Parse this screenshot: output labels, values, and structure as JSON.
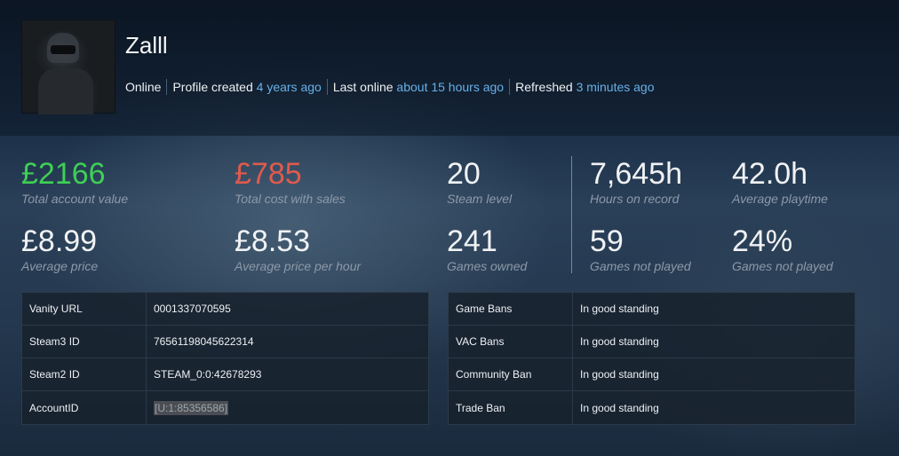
{
  "profile": {
    "username": "Zalll",
    "status": "Online",
    "created_label": "Profile created",
    "created_value": "4 years ago",
    "last_online_label": "Last online",
    "last_online_value": "about 15 hours ago",
    "refreshed_label": "Refreshed",
    "refreshed_value": "3 minutes ago"
  },
  "stats": [
    {
      "value": "£2166",
      "label": "Total account value",
      "color": "#3fcf55"
    },
    {
      "value": "£785",
      "label": "Total cost with sales",
      "color": "#e05a4e"
    },
    {
      "value": "20",
      "label": "Steam level"
    },
    {
      "value": "7,645h",
      "label": "Hours on record"
    },
    {
      "value": "42.0h",
      "label": "Average playtime"
    },
    {
      "value": "£8.99",
      "label": "Average price"
    },
    {
      "value": "£8.53",
      "label": "Average price per hour"
    },
    {
      "value": "241",
      "label": "Games owned"
    },
    {
      "value": "59",
      "label": "Games not played"
    },
    {
      "value": "24%",
      "label": "Games not played"
    }
  ],
  "ids_table": [
    {
      "key": "Vanity URL",
      "value": "0001337070595"
    },
    {
      "key": "Steam3 ID",
      "value": "76561198045622314"
    },
    {
      "key": "Steam2 ID",
      "value": "STEAM_0:0:42678293"
    },
    {
      "key": "AccountID",
      "value": "[U:1:85356586]"
    }
  ],
  "bans_table": [
    {
      "key": "Game Bans",
      "value": "In good standing"
    },
    {
      "key": "VAC Bans",
      "value": "In good standing"
    },
    {
      "key": "Community Ban",
      "value": "In good standing"
    },
    {
      "key": "Trade Ban",
      "value": "In good standing"
    }
  ]
}
